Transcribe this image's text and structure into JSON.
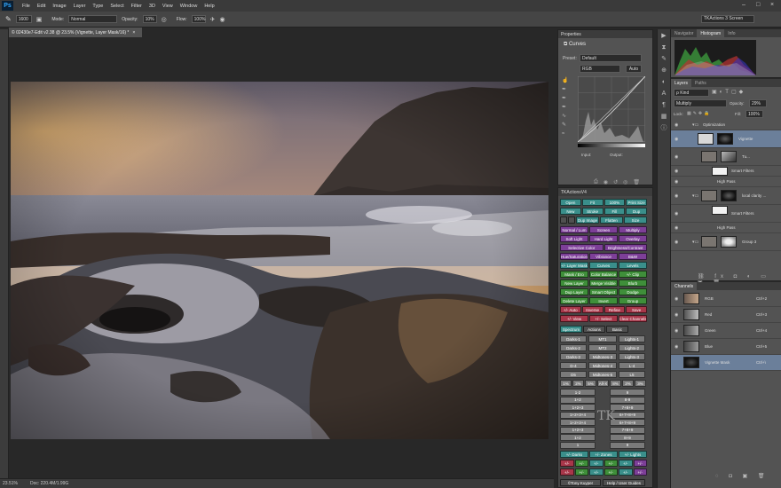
{
  "app": {
    "logo": "Ps"
  },
  "menu": [
    "File",
    "Edit",
    "Image",
    "Layer",
    "Type",
    "Select",
    "Filter",
    "3D",
    "View",
    "Window",
    "Help"
  ],
  "options": {
    "brush_size": "1600",
    "mode_label": "Mode:",
    "mode_value": "Normal",
    "opacity_label": "Opacity:",
    "opacity_value": "10%",
    "flow_label": "Flow:",
    "flow_value": "100%",
    "workspace": "TKActions 3 Screen"
  },
  "document": {
    "tab_title": "© 02430e7-Edit v2.38 @ 23.5% (Vignette, Layer Mask/16) *",
    "tab_close": "×"
  },
  "status": {
    "zoom": "23.51%",
    "doc": "Doc: 220.4M/1.99G"
  },
  "properties": {
    "tab": "Properties",
    "title": "Curves",
    "preset_label": "Preset:",
    "preset_value": "Default",
    "channel_value": "RGB",
    "auto_label": "Auto",
    "input_label": "Input:",
    "output_label": "Output:"
  },
  "tk": {
    "title": "TKActionsV4",
    "r1": [
      "Open",
      "Fit",
      "100%",
      "Print Size"
    ],
    "r2": [
      "New",
      "Stroke",
      "Fill",
      "Dup"
    ],
    "r3": [
      "Dup Image",
      "Flatten",
      "Size"
    ],
    "purple": [
      [
        "Normal / Lum",
        "Screen",
        "Multiply"
      ],
      [
        "Soft Light",
        "Hard Light",
        "Overlay"
      ],
      [
        "Selective Color",
        "Brightness/Contrast"
      ],
      [
        "Hue/Saturation",
        "Vibrance",
        "B&W"
      ]
    ],
    "r8": [
      "+/- Layer Mask",
      "Curves",
      "Levels"
    ],
    "green": [
      [
        "Mask / Ero",
        "Color Balance",
        "+/- Clip"
      ],
      [
        "New Layer",
        "Merge Visible",
        "Blurb"
      ],
      [
        "Dup Layer",
        "Smart Object",
        "Dodge"
      ],
      [
        "Delete Layer",
        "Invert",
        "Group"
      ]
    ],
    "red": [
      [
        "+/- Auto",
        "Inverse",
        "Refine",
        "Save"
      ],
      [
        "+/- View",
        "+/- Select",
        "Clear Channels"
      ]
    ],
    "tabs": [
      "Spectrum",
      "Actions",
      "Basic"
    ],
    "spectrum": [
      [
        "Darks-1",
        "MT1",
        "Lights-1"
      ],
      [
        "Darks-2",
        "MT2",
        "Lights-2"
      ],
      [
        "Darks-3",
        "Midtones-3",
        "Lights-3"
      ],
      [
        "D-4",
        "Midtones-4",
        "L-4"
      ],
      [
        "D5",
        "Midtones-5",
        "L5"
      ]
    ],
    "numrow": [
      "1%",
      "2%",
      "5%",
      "All-X",
      "8%",
      "2%",
      "3%"
    ],
    "zone_left": [
      "1-2",
      "1+2",
      "1+2+3",
      "1+2+3+4",
      "1+2+3+4",
      "1+2+3",
      "1+2",
      "1"
    ],
    "zone_right": [
      "9",
      "8-9",
      "7+8+9",
      "6+7+8+9",
      "6+7+8+9",
      "7+8+9",
      "8+9",
      "9"
    ],
    "zones": [
      "+/- Darks",
      "+/- Zones",
      "+/- Lights"
    ],
    "mod1": [
      "+/-",
      "+/-",
      "+/-",
      "+/-",
      "+/-",
      "+/-"
    ],
    "mod2": [
      "+/-",
      "+/-",
      "+/-",
      "+/-",
      "+/-",
      "+/-"
    ],
    "footer": [
      "©Tony Kuyper",
      "Help / User Guides"
    ]
  },
  "histogram": {
    "tabs": [
      "Navigator",
      "Histogram",
      "Info"
    ]
  },
  "layers": {
    "tabs": [
      "Layers",
      "Paths"
    ],
    "kind": "ρ Kind",
    "blend": "Multiply",
    "opacity_label": "Opacity:",
    "opacity_value": "29%",
    "lock_label": "Lock:",
    "fill_label": "Fill:",
    "fill_value": "100%",
    "items": [
      {
        "name": "Optimization",
        "type": "group"
      },
      {
        "name": "Vignette",
        "type": "adj"
      },
      {
        "name": "Tu...",
        "type": "smart"
      },
      {
        "name": "Smart Filters",
        "type": "filter"
      },
      {
        "name": "High Pass",
        "type": "fx"
      },
      {
        "name": "local clarity ...",
        "type": "group2"
      },
      {
        "name": "Smart Filters",
        "type": "filter"
      },
      {
        "name": "High Pass",
        "type": "fx"
      },
      {
        "name": "Group 3",
        "type": "group3"
      }
    ]
  },
  "channels": {
    "tab": "Channels",
    "items": [
      {
        "name": "RGB",
        "key": "Ctrl+2"
      },
      {
        "name": "Red",
        "key": "Ctrl+3"
      },
      {
        "name": "Green",
        "key": "Ctrl+4"
      },
      {
        "name": "Blue",
        "key": "Ctrl+5"
      },
      {
        "name": "Vignette Mask",
        "key": "Ctrl+\\"
      }
    ]
  },
  "colors": {
    "accent": "#31a8ff",
    "teal": "#3a8f8b",
    "purple": "#7d3f98",
    "green": "#3f8f3a",
    "red": "#a8374a"
  }
}
